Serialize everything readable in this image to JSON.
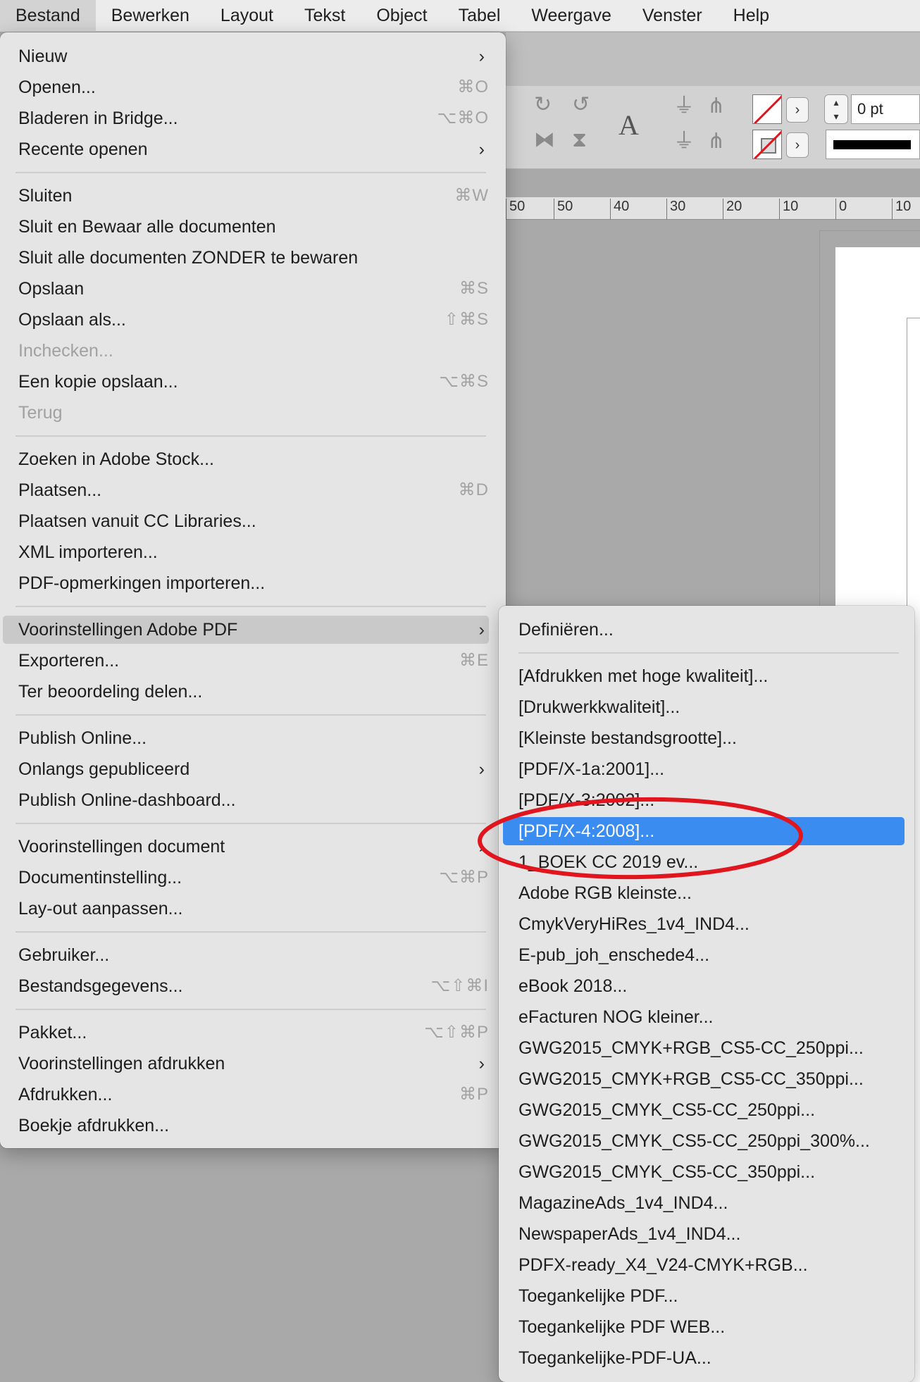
{
  "menubar": {
    "items": [
      {
        "label": "Bestand"
      },
      {
        "label": "Bewerken"
      },
      {
        "label": "Layout"
      },
      {
        "label": "Tekst"
      },
      {
        "label": "Object"
      },
      {
        "label": "Tabel"
      },
      {
        "label": "Weergave"
      },
      {
        "label": "Venster"
      },
      {
        "label": "Help"
      }
    ]
  },
  "control_panel": {
    "type_icon": "A",
    "stroke_weight": "0 pt"
  },
  "ruler": {
    "labels": [
      "50",
      "50",
      "40",
      "30",
      "20",
      "10",
      "0",
      "10"
    ]
  },
  "file_menu": {
    "items": [
      {
        "label": "Nieuw",
        "shortcut": "",
        "chevron": "›"
      },
      {
        "label": "Openen...",
        "shortcut": "⌘O"
      },
      {
        "label": "Bladeren in Bridge...",
        "shortcut": "⌥⌘O"
      },
      {
        "label": "Recente openen",
        "shortcut": "",
        "chevron": "›"
      },
      {
        "label": "Sluiten",
        "shortcut": "⌘W"
      },
      {
        "label": "Sluit en Bewaar alle documenten",
        "shortcut": ""
      },
      {
        "label": "Sluit alle documenten ZONDER te bewaren",
        "shortcut": ""
      },
      {
        "label": "Opslaan",
        "shortcut": "⌘S"
      },
      {
        "label": "Opslaan als...",
        "shortcut": "⇧⌘S"
      },
      {
        "label": "Inchecken...",
        "shortcut": ""
      },
      {
        "label": "Een kopie opslaan...",
        "shortcut": "⌥⌘S"
      },
      {
        "label": "Terug",
        "shortcut": ""
      },
      {
        "label": "Zoeken in Adobe Stock...",
        "shortcut": ""
      },
      {
        "label": "Plaatsen...",
        "shortcut": "⌘D"
      },
      {
        "label": "Plaatsen vanuit CC Libraries...",
        "shortcut": ""
      },
      {
        "label": "XML importeren...",
        "shortcut": ""
      },
      {
        "label": "PDF-opmerkingen importeren...",
        "shortcut": ""
      },
      {
        "label": "Voorinstellingen Adobe PDF",
        "shortcut": "",
        "chevron": "›"
      },
      {
        "label": "Exporteren...",
        "shortcut": "⌘E"
      },
      {
        "label": "Ter beoordeling delen...",
        "shortcut": ""
      },
      {
        "label": "Publish Online...",
        "shortcut": ""
      },
      {
        "label": "Onlangs gepubliceerd",
        "shortcut": "",
        "chevron": "›"
      },
      {
        "label": "Publish Online-dashboard...",
        "shortcut": ""
      },
      {
        "label": "Voorinstellingen document",
        "shortcut": "",
        "chevron": "›"
      },
      {
        "label": "Documentinstelling...",
        "shortcut": "⌥⌘P"
      },
      {
        "label": "Lay-out aanpassen...",
        "shortcut": ""
      },
      {
        "label": "Gebruiker...",
        "shortcut": ""
      },
      {
        "label": "Bestandsgegevens...",
        "shortcut": "⌥⇧⌘I"
      },
      {
        "label": "Pakket...",
        "shortcut": "⌥⇧⌘P"
      },
      {
        "label": "Voorinstellingen afdrukken",
        "shortcut": "",
        "chevron": "›"
      },
      {
        "label": "Afdrukken...",
        "shortcut": "⌘P"
      },
      {
        "label": "Boekje afdrukken...",
        "shortcut": ""
      }
    ]
  },
  "pdf_presets_menu": {
    "items": [
      {
        "label": "Definiëren..."
      },
      {
        "label": "[Afdrukken met hoge kwaliteit]..."
      },
      {
        "label": "[Drukwerkkwaliteit]..."
      },
      {
        "label": "[Kleinste bestandsgrootte]..."
      },
      {
        "label": "[PDF/X-1a:2001]..."
      },
      {
        "label": "[PDF/X-3:2002]..."
      },
      {
        "label": "[PDF/X-4:2008]..."
      },
      {
        "label": "1_BOEK CC 2019 ev..."
      },
      {
        "label": "Adobe RGB kleinste..."
      },
      {
        "label": "CmykVeryHiRes_1v4_IND4..."
      },
      {
        "label": "E-pub_joh_enschede4..."
      },
      {
        "label": "eBook 2018..."
      },
      {
        "label": "eFacturen NOG kleiner..."
      },
      {
        "label": "GWG2015_CMYK+RGB_CS5-CC_250ppi..."
      },
      {
        "label": "GWG2015_CMYK+RGB_CS5-CC_350ppi..."
      },
      {
        "label": "GWG2015_CMYK_CS5-CC_250ppi..."
      },
      {
        "label": "GWG2015_CMYK_CS5-CC_250ppi_300%..."
      },
      {
        "label": "GWG2015_CMYK_CS5-CC_350ppi..."
      },
      {
        "label": "MagazineAds_1v4_IND4..."
      },
      {
        "label": "NewspaperAds_1v4_IND4..."
      },
      {
        "label": "PDFX-ready_X4_V24-CMYK+RGB..."
      },
      {
        "label": "Toegankelijke PDF..."
      },
      {
        "label": "Toegankelijke PDF WEB..."
      },
      {
        "label": "Toegankelijke-PDF-UA..."
      }
    ]
  },
  "colors": {
    "selection": "#3b8cf0",
    "annotation": "#e0151e",
    "menu_bg": "#e5e5e5"
  }
}
